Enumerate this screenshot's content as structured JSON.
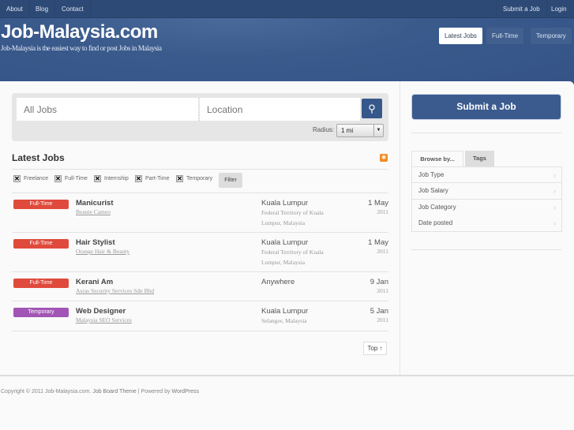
{
  "topnav": {
    "left": [
      "About",
      "Blog",
      "Contact"
    ],
    "right": [
      "Submit a Job",
      "Login"
    ]
  },
  "header": {
    "title": "Job-Malaysia.com",
    "tagline": "Job-Malaysia is the easiest way to find or post Jobs in Malaysia",
    "tabs": [
      "Latest Jobs",
      "Full-Time",
      "Temporary"
    ]
  },
  "search": {
    "keyword_placeholder": "All Jobs",
    "location_placeholder": "Location",
    "radius_label": "Radius:",
    "radius_value": "1 mi"
  },
  "jobs": {
    "heading": "Latest Jobs",
    "filters": [
      "Freelance",
      "Full-Time",
      "Internship",
      "Part-Time",
      "Temporary"
    ],
    "filter_button": "Filter",
    "rows": [
      {
        "type": "Full-Time",
        "color": "#e04a3c",
        "title": "Manicurist",
        "company": "Beaute Cameo",
        "city": "Kuala Lumpur",
        "region": "Federal Territory of Kuala Lumpur, Malaysia",
        "date": "1 May",
        "year": "2011"
      },
      {
        "type": "Full-Time",
        "color": "#e04a3c",
        "title": "Hair Stylist",
        "company": "Orange Hair & Beauty",
        "city": "Kuala Lumpur",
        "region": "Federal Territory of Kuala Lumpur, Malaysia",
        "date": "1 May",
        "year": "2011"
      },
      {
        "type": "Full-Time",
        "color": "#e04a3c",
        "title": "Kerani Am",
        "company": "Asras Security Services Sdn Bhd",
        "city": "Anywhere",
        "region": "",
        "date": "9 Jan",
        "year": "2011"
      },
      {
        "type": "Temporary",
        "color": "#a156b5",
        "title": "Web Designer",
        "company": "Malaysia SEO Services",
        "city": "Kuala Lumpur",
        "region": "Selangor, Malaysia",
        "date": "5 Jan",
        "year": "2011"
      }
    ],
    "top_button": "Top ↑"
  },
  "sidebar": {
    "submit_button": "Submit a Job",
    "tabs": [
      "Browse by...",
      "Tags"
    ],
    "items": [
      "Job Type",
      "Job Salary",
      "Job Category",
      "Date posted"
    ]
  },
  "footer": {
    "copyright": "Copyright © 2011 Job-Malaysia.com.",
    "theme_link": "Job Board Theme",
    "powered": "| Powered by",
    "wp_link": "WordPress"
  }
}
